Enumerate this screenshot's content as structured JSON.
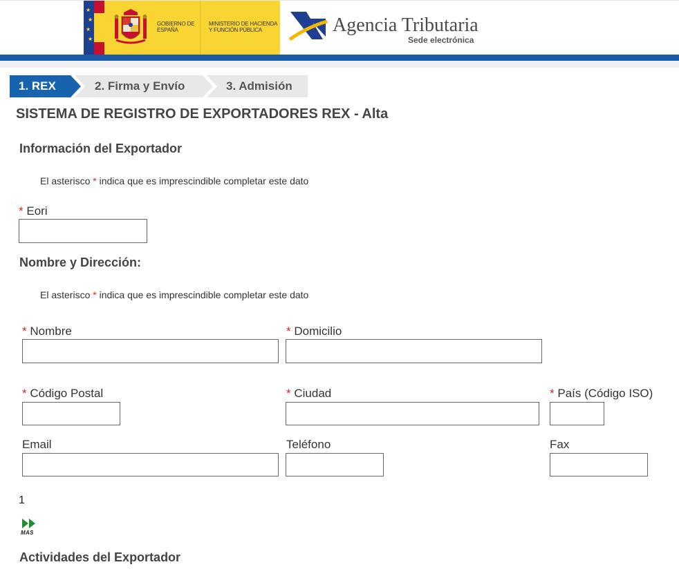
{
  "header": {
    "gov_text": "GOBIERNO DE ESPAÑA",
    "ministry_text": "MINISTERIO DE HACIENDA Y FUNCIÓN PÚBLICA",
    "agency_name": "Agencia Tributaria",
    "agency_sub": "Sede electrónica",
    "colors": {
      "accent_blue": "#1c5aa8",
      "gov_yellow": "#f8d532"
    }
  },
  "steps": [
    {
      "label": "1. REX",
      "active": true
    },
    {
      "label": "2. Firma y Envío",
      "active": false
    },
    {
      "label": "3. Admisión",
      "active": false
    }
  ],
  "page_title": "SISTEMA DE REGISTRO DE EXPORTADORES REX - Alta",
  "exporter_info": {
    "title": "Información del Exportador",
    "note_prefix": "El asterisco",
    "note_star": "*",
    "note_suffix": "indica que es imprescindible completar este dato",
    "eori": {
      "required_mark": "*",
      "label": "Eori",
      "value": ""
    }
  },
  "name_address": {
    "title": "Nombre y Dirección:",
    "note_prefix": "El asterisco",
    "note_star": "*",
    "note_suffix": "indica que es imprescindible completar este dato",
    "fields": {
      "nombre": {
        "required_mark": "*",
        "label": "Nombre",
        "value": ""
      },
      "domicilio": {
        "required_mark": "*",
        "label": "Domicilio",
        "value": ""
      },
      "codigo_postal": {
        "required_mark": "*",
        "label": "Código Postal",
        "value": ""
      },
      "ciudad": {
        "required_mark": "*",
        "label": "Ciudad",
        "value": ""
      },
      "pais": {
        "required_mark": "*",
        "label": "País (Código ISO)",
        "value": ""
      },
      "email": {
        "label": "Email",
        "value": ""
      },
      "telefono": {
        "label": "Teléfono",
        "value": ""
      },
      "fax": {
        "label": "Fax",
        "value": ""
      }
    },
    "page_number": "1",
    "more_label": "MAS",
    "more_icon": "double-arrow-right-icon"
  },
  "activities": {
    "title": "Actividades del Exportador"
  }
}
